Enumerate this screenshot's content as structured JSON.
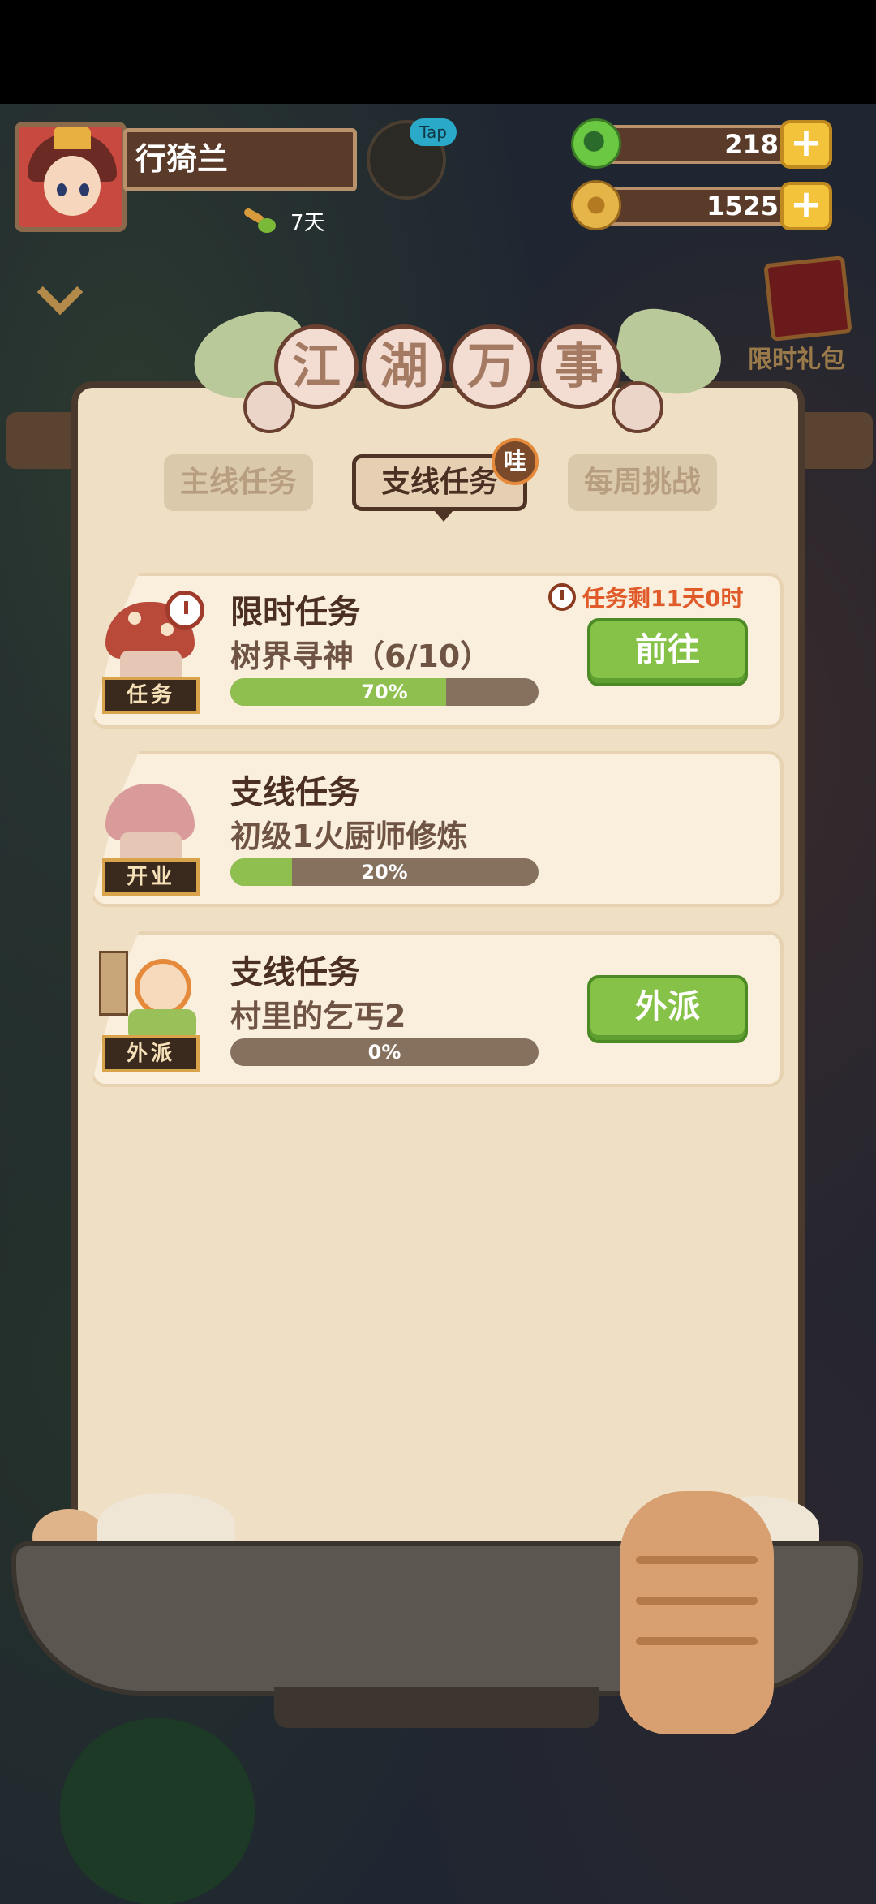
{
  "player": {
    "name": "行猗兰",
    "days": "7天"
  },
  "tap_label": "Tap",
  "currency": {
    "jade": "218",
    "gold": "1525"
  },
  "limited_gift": {
    "label": "限时礼包"
  },
  "panel": {
    "title_chars": [
      "江",
      "湖",
      "万",
      "事"
    ],
    "tabs": [
      {
        "label": "主线任务",
        "active": false
      },
      {
        "label": "支线任务",
        "active": true
      },
      {
        "label": "每周挑战",
        "active": false
      }
    ],
    "tab_badge": "哇"
  },
  "tasks": [
    {
      "title": "限时任务",
      "subtitle": "树界寻神（6/10）",
      "progress": 70,
      "progress_label": "70%",
      "icon_sign": "任务",
      "timer": "任务剩11天0时",
      "button": "前往"
    },
    {
      "title": "支线任务",
      "subtitle": "初级1火厨师修炼",
      "progress": 20,
      "progress_label": "20%",
      "icon_sign": "开业"
    },
    {
      "title": "支线任务",
      "subtitle": "村里的乞丐2",
      "progress": 0,
      "progress_label": "0%",
      "icon_sign": "外派",
      "button": "外派"
    }
  ],
  "colors": {
    "button_green": "#86c248",
    "progress_green": "#8fc04f",
    "timer_red": "#e05a2a",
    "panel_bg": "#efdfc4"
  }
}
